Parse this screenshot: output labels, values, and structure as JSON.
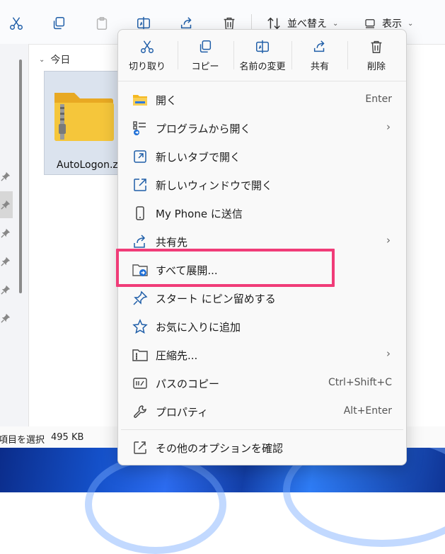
{
  "toolbar": {
    "sort_label": "並べ替え",
    "view_label": "表示"
  },
  "content": {
    "group_header": "今日",
    "file_name": "AutoLogon.z"
  },
  "status_bar": {
    "selection_text": "項目を選択",
    "size_text": "495 KB"
  },
  "context_menu": {
    "quick_actions": {
      "cut": "切り取り",
      "copy": "コピー",
      "rename": "名前の変更",
      "share": "共有",
      "delete": "削除"
    },
    "items": [
      {
        "label": "開く",
        "shortcut": "Enter"
      },
      {
        "label": "プログラムから開く",
        "shortcut": ""
      },
      {
        "label": "新しいタブで開く",
        "shortcut": ""
      },
      {
        "label": "新しいウィンドウで開く",
        "shortcut": ""
      },
      {
        "label": "My Phone に送信",
        "shortcut": ""
      },
      {
        "label": "共有先",
        "shortcut": ""
      },
      {
        "label": "すべて展開...",
        "shortcut": ""
      },
      {
        "label": "スタート にピン留めする",
        "shortcut": ""
      },
      {
        "label": "お気に入りに追加",
        "shortcut": ""
      },
      {
        "label": "圧縮先...",
        "shortcut": ""
      },
      {
        "label": "パスのコピー",
        "shortcut": "Ctrl+Shift+C"
      },
      {
        "label": "プロパティ",
        "shortcut": "Alt+Enter"
      },
      {
        "label": "その他のオプションを確認",
        "shortcut": ""
      }
    ]
  },
  "colors": {
    "highlight_border": "#f03c78",
    "accent": "#0067c0",
    "folder_yellow": "#f5c63b"
  }
}
